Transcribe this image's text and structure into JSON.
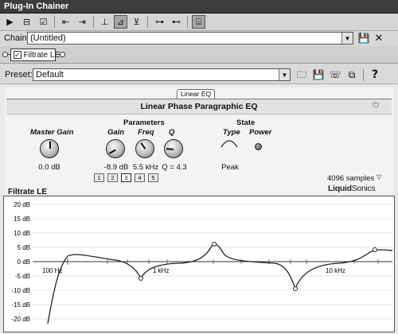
{
  "window": {
    "title": "Plug-In Chainer"
  },
  "toolbar": {
    "buttons": [
      {
        "name": "play-icon",
        "glyph": "▶"
      },
      {
        "name": "chain-view-icon",
        "glyph": "⊟"
      },
      {
        "name": "chain-check-icon",
        "glyph": "☑"
      },
      {
        "name": "move-left-icon",
        "glyph": "⇤"
      },
      {
        "name": "move-right-icon",
        "glyph": "⇥"
      },
      {
        "name": "routing-icon",
        "glyph": "⊥"
      },
      {
        "name": "routing-active-icon",
        "glyph": "⊿"
      },
      {
        "name": "routing-alt-icon",
        "glyph": "⊻"
      },
      {
        "name": "insert-plugin-icon",
        "glyph": "⊶"
      },
      {
        "name": "remove-plugin-icon",
        "glyph": "⊷"
      },
      {
        "name": "chain-settings-icon",
        "glyph": "⌸"
      }
    ]
  },
  "chain": {
    "label": "Chain:",
    "value": "(Untitled)"
  },
  "plugin_tab": {
    "label": "Filtrate LE",
    "checked": true
  },
  "preset": {
    "label": "Preset:",
    "value": "Default"
  },
  "eq": {
    "tab_label": "Linear EQ",
    "header": "Linear Phase Paragraphic EQ",
    "master_gain": {
      "label": "Master Gain",
      "value": "0.0 dB"
    },
    "parameters": {
      "title": "Parameters",
      "gain": {
        "label": "Gain",
        "value": "-8.9 dB"
      },
      "freq": {
        "label": "Freq",
        "value": "5.5 kHz"
      },
      "q": {
        "label": "Q",
        "value": "Q = 4.3"
      }
    },
    "bands": [
      "1",
      "2",
      "3",
      "4",
      "5"
    ],
    "selected_band": 3,
    "state": {
      "title": "State",
      "type_label": "Type",
      "power_label": "Power",
      "type_value": "Peak"
    },
    "samples": "4096 samples",
    "brand_bold": "Liquid",
    "brand_thin": "Sonics"
  },
  "graph": {
    "label": "Filtrate LE",
    "y_labels": [
      "20 dB",
      "15 dB",
      "10 dB",
      "5 dB",
      "0 dB",
      "-5 dB",
      "-10 dB",
      "-15 dB",
      "-20 dB"
    ],
    "freq_labels": [
      "100 Hz",
      "1 kHz",
      "10 kHz"
    ],
    "line_color": "#222222",
    "grid_color": "#bdbdbd"
  }
}
